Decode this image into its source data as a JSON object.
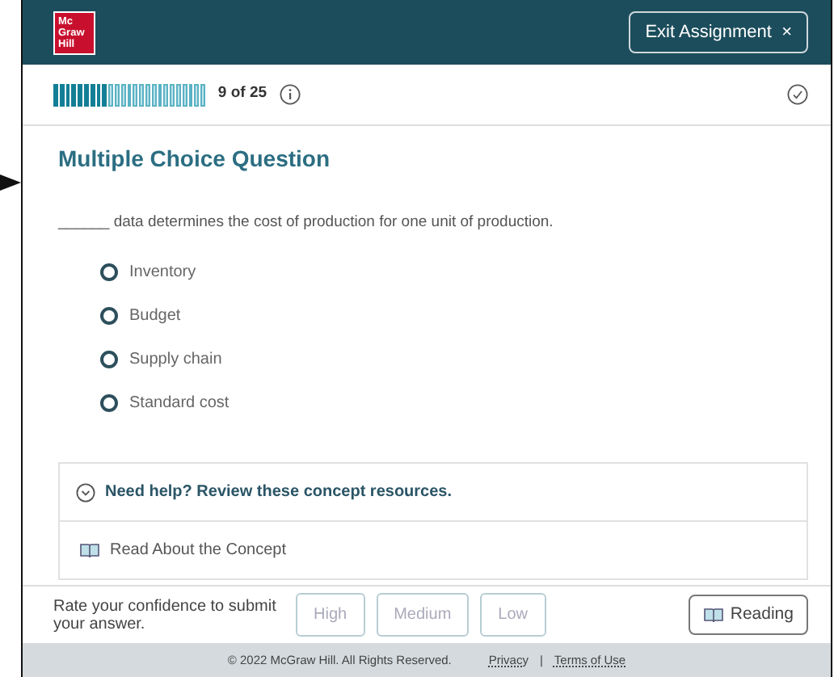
{
  "header": {
    "logo": [
      "Mc",
      "Graw",
      "Hill"
    ],
    "exit_button": {
      "label": "Exit Assignment",
      "icon": "×"
    }
  },
  "progress": {
    "level": 0.36,
    "label": "9 of 25"
  },
  "question": {
    "type": "Multiple Choice Question",
    "prompt": "______ data determines the cost of production for one unit of production.",
    "options": [
      {
        "label": "Inventory",
        "selected": false
      },
      {
        "label": "Budget",
        "selected": false
      },
      {
        "label": "Supply chain",
        "selected": false
      },
      {
        "label": "Standard cost",
        "selected": false
      }
    ]
  },
  "help": {
    "title": "Need help? Review these concept resources.",
    "expanded": true,
    "resources": [
      "Read About the Concept"
    ]
  },
  "confidence": {
    "prompt": "Rate your confidence to submit your answer.",
    "buttons": [
      {
        "label": "High",
        "disabled": true
      },
      {
        "label": "Medium",
        "disabled": true
      },
      {
        "label": "Low",
        "disabled": true
      }
    ],
    "reading_button": "Reading"
  },
  "footer": {
    "copyright": "© 2022 McGraw Hill. All Rights Reserved.",
    "links": [
      "Privacy",
      "Terms of Use"
    ],
    "separator": "|"
  }
}
